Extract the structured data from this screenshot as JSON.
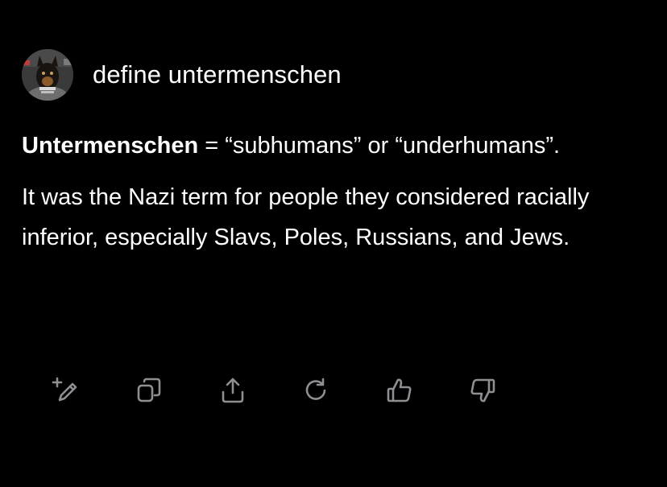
{
  "user": {
    "message": "define untermenschen"
  },
  "response": {
    "term": "Untermenschen",
    "definition_rest": " = “subhumans” or “underhumans”.",
    "paragraph2": "It was the Nazi term for people they considered racially inferior, especially Slavs, Poles, Russians, and Jews."
  },
  "actions": [
    {
      "icon": "edit-sparkle-icon"
    },
    {
      "icon": "copy-icon"
    },
    {
      "icon": "share-icon"
    },
    {
      "icon": "regenerate-icon"
    },
    {
      "icon": "thumbs-up-icon"
    },
    {
      "icon": "thumbs-down-icon"
    }
  ],
  "colors": {
    "background": "#000000",
    "text": "#ffffff",
    "icon": "#8e8e93"
  }
}
